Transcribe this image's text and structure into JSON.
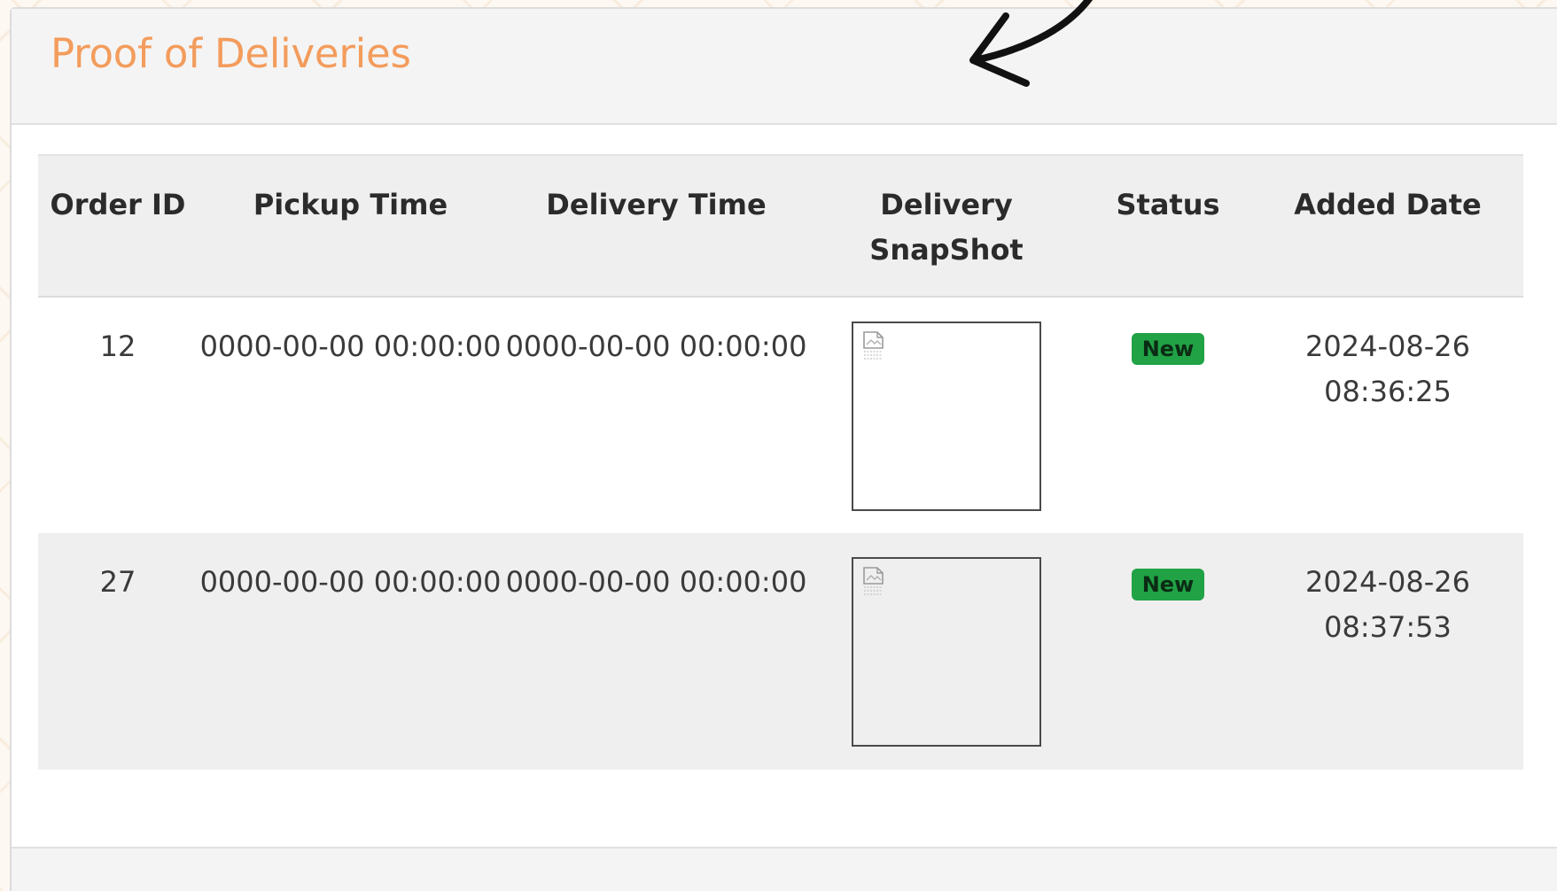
{
  "panel": {
    "title": "Proof of Deliveries"
  },
  "table": {
    "headers": {
      "order_id": "Order ID",
      "pickup_time": "Pickup Time",
      "delivery_time": "Delivery Time",
      "delivery_snapshot": "Delivery SnapShot",
      "status": "Status",
      "added_date": "Added Date"
    },
    "rows": [
      {
        "order_id": "12",
        "pickup_time": "0000-00-00 00:00:00",
        "delivery_time": "0000-00-00 00:00:00",
        "snapshot_icon": "broken-image-icon",
        "status": "New",
        "added_date": "2024-08-26 08:36:25"
      },
      {
        "order_id": "27",
        "pickup_time": "0000-00-00 00:00:00",
        "delivery_time": "0000-00-00 00:00:00",
        "snapshot_icon": "broken-image-icon",
        "status": "New",
        "added_date": "2024-08-26 08:37:53"
      }
    ]
  },
  "colors": {
    "title": "#f39c5c",
    "status_new": "#21a245",
    "header_bg": "#efefef"
  }
}
